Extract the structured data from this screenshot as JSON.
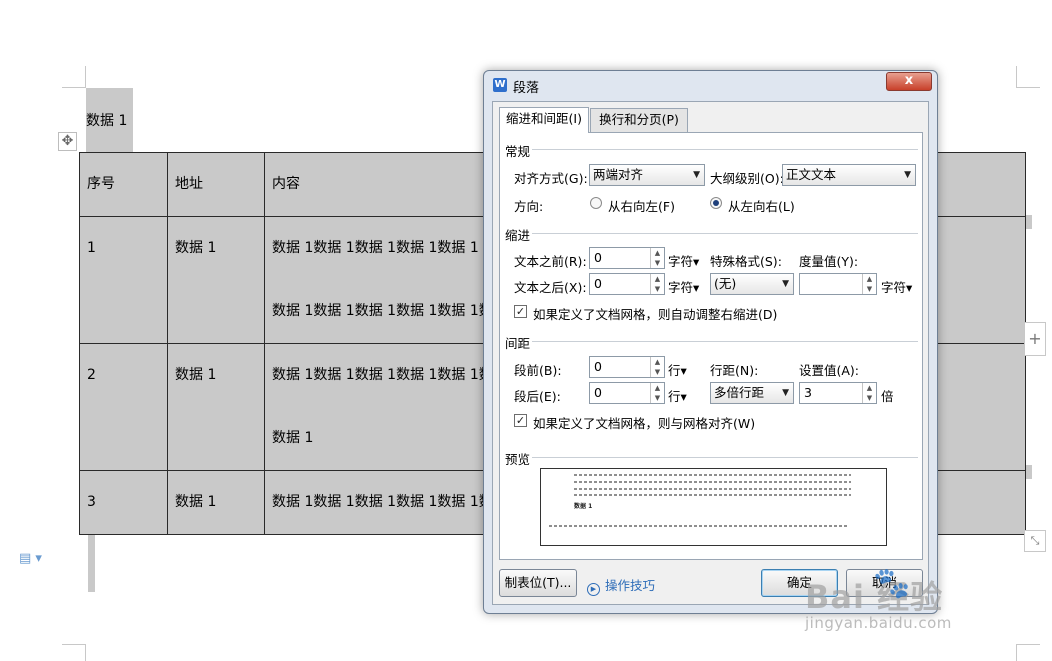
{
  "document": {
    "title": "数据 1",
    "move_handle_glyph": "✥",
    "table": {
      "headers": [
        "序号",
        "地址",
        "内容"
      ],
      "rows": [
        {
          "no": "1",
          "addr": "数据 1",
          "lines": [
            "数据 1数据 1数据 1数据 1数据 1",
            "数据 1数据 1数据 1数据 1数据 1数"
          ]
        },
        {
          "no": "2",
          "addr": "数据 1",
          "lines": [
            "数据 1数据 1数据 1数据 1数据 1数",
            "数据 1"
          ]
        },
        {
          "no": "3",
          "addr": "数据 1",
          "lines": [
            "数据 1数据 1数据 1数据 1数据 1数"
          ]
        }
      ]
    },
    "add_glyph": "+",
    "resize_glyph": "⤡",
    "doc_icon_glyph": "▤ ▾"
  },
  "dialog": {
    "app_icon": "W",
    "title": "段落",
    "close_glyph": "x",
    "tabs": [
      "缩进和间距(I)",
      "换行和分页(P)"
    ],
    "general": {
      "heading": "常规",
      "alignment_label": "对齐方式(G):",
      "alignment_value": "两端对齐",
      "outline_label": "大纲级别(O):",
      "outline_value": "正文文本",
      "direction_label": "方向:",
      "rtl_label": "从右向左(F)",
      "ltr_label": "从左向右(L)"
    },
    "indent": {
      "heading": "缩进",
      "before_label": "文本之前(R):",
      "before_value": "0",
      "after_label": "文本之后(X):",
      "after_value": "0",
      "unit": "字符▾",
      "special_label": "特殊格式(S):",
      "special_value": "(无)",
      "measure_label": "度量值(Y):",
      "measure_value": "",
      "measure_unit": "字符▾",
      "auto_adjust_label": "如果定义了文档网格，则自动调整右缩进(D)"
    },
    "spacing": {
      "heading": "间距",
      "before_label": "段前(B):",
      "before_value": "0",
      "after_label": "段后(E):",
      "after_value": "0",
      "unit": "行▾",
      "line_label": "行距(N):",
      "line_value": "多倍行距",
      "setting_label": "设置值(A):",
      "setting_value": "3",
      "setting_unit": "倍",
      "grid_align_label": "如果定义了文档网格，则与网格对齐(W)"
    },
    "preview": {
      "heading": "预览",
      "sample_bold": "数据 1"
    },
    "buttons": {
      "tabs": "制表位(T)...",
      "tips": "操作技巧",
      "ok": "确定",
      "cancel": "取消"
    }
  },
  "watermark": {
    "main": "Bai  经验",
    "paw": "🐾",
    "sub": "jingyan.baidu.com"
  }
}
